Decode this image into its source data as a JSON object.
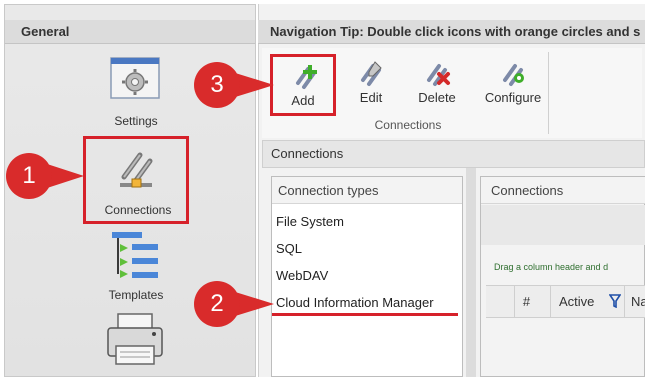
{
  "sidebar": {
    "header": "General",
    "items": [
      {
        "label": "Settings",
        "icon": "settings-icon"
      },
      {
        "label": "Connections",
        "icon": "connections-icon"
      },
      {
        "label": "Templates",
        "icon": "templates-icon"
      },
      {
        "label": "",
        "icon": "printer-icon"
      }
    ]
  },
  "tip": {
    "text": "Navigation Tip: Double click icons with orange circles and s"
  },
  "ribbon": {
    "buttons": [
      {
        "label": "Add",
        "icon": "add-connection-icon"
      },
      {
        "label": "Edit",
        "icon": "edit-connection-icon"
      },
      {
        "label": "Delete",
        "icon": "delete-connection-icon"
      },
      {
        "label": "Configure",
        "icon": "configure-connection-icon"
      }
    ],
    "group_label": "Connections"
  },
  "section": {
    "title": "Connections"
  },
  "connection_types": {
    "header": "Connection types",
    "items": [
      "File System",
      "SQL",
      "WebDAV",
      "Cloud Information Manager"
    ]
  },
  "connections": {
    "header": "Connections",
    "drag_tip": "Drag a column header and d",
    "columns": [
      "#",
      "Active",
      "Na"
    ]
  },
  "callouts": [
    "1",
    "2",
    "3"
  ],
  "colors": {
    "highlight": "#d6212a",
    "badge": "#d92b2b",
    "accent": "#2f6f2f"
  }
}
